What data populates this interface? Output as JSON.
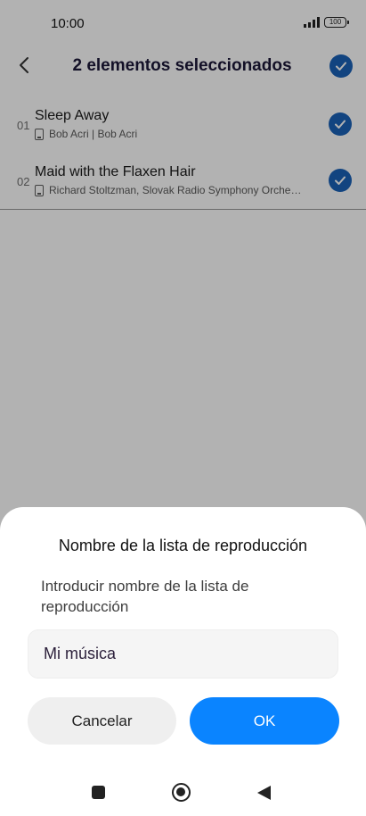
{
  "status_bar": {
    "time": "10:00",
    "battery": "100"
  },
  "header": {
    "title": "2 elementos seleccionados"
  },
  "songs": [
    {
      "number": "01",
      "title": "Sleep Away",
      "artist": "Bob Acri | Bob Acri",
      "selected": true
    },
    {
      "number": "02",
      "title": "Maid with the Flaxen Hair",
      "artist": "Richard Stoltzman, Slovak Radio Symphony Orche…",
      "selected": true
    }
  ],
  "dialog": {
    "title": "Nombre de la lista de reproducción",
    "message": "Introducir nombre de la lista de reproducción",
    "input_value": "Mi música",
    "cancel_label": "Cancelar",
    "ok_label": "OK"
  },
  "colors": {
    "accent": "#1a62b8",
    "ok_button": "#0a84ff",
    "title_text": "#1c1838"
  },
  "icons": {
    "back": "chevron-left-icon",
    "check": "checkmark-icon",
    "storage": "phone-storage-icon",
    "nav_recent": "square-icon",
    "nav_home": "circle-icon",
    "nav_back": "triangle-back-icon"
  }
}
